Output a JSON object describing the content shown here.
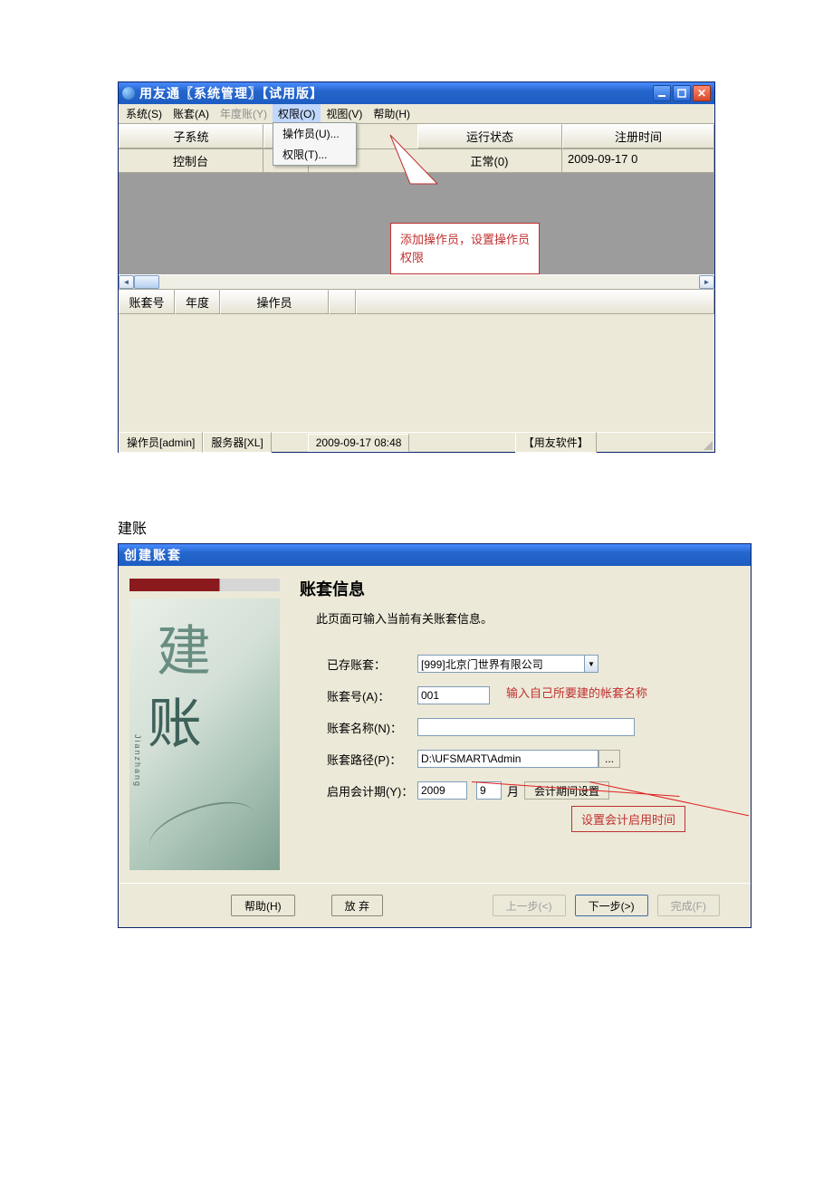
{
  "win1": {
    "title": "用友通〖系统管理〗【试用版】",
    "menu": {
      "system": "系统(S)",
      "account": "账套(A)",
      "year": "年度账(Y)",
      "auth": "权限(O)",
      "view": "视图(V)",
      "help": "帮助(H)"
    },
    "dropdown": {
      "operator": "操作员(U)...",
      "permission": "权限(T)..."
    },
    "cols": {
      "subsystem": "子系统",
      "runstate": "运行状态",
      "regtime": "注册时间"
    },
    "row": {
      "console": "控制台",
      "normal": "正常(0)",
      "time": "2009-09-17 0"
    },
    "callout": "添加操作员，设置操作员权限",
    "cols2": {
      "acct": "账套号",
      "year": "年度",
      "op": "操作员"
    },
    "status": {
      "op": "操作员[admin]",
      "srv": "服务器[XL]",
      "time": "2009-09-17 08:48",
      "brand": "【用友软件】"
    }
  },
  "section_label": "建账",
  "win2": {
    "title": "创建账套",
    "side": {
      "h1": "建",
      "h2": "账",
      "pinyin": "Jianzhang"
    },
    "heading": "账套信息",
    "subheading": "此页面可输入当前有关账套信息。",
    "labels": {
      "exist": "已存账套：",
      "num": "账套号(A)：",
      "name": "账套名称(N)：",
      "path": "账套路径(P)：",
      "period": "启用会计期(Y)："
    },
    "values": {
      "exist": "[999]北京门世界有限公司",
      "num": "001",
      "name": "",
      "path": "D:\\UFSMART\\Admin",
      "year": "2009",
      "month": "9"
    },
    "units": {
      "month": "月"
    },
    "buttons": {
      "browse": "...",
      "period_setting": "会计期间设置",
      "help": "帮助(H)",
      "cancel": "放 弃",
      "prev": "上一步(<)",
      "next": "下一步(>)",
      "finish": "完成(F)"
    },
    "notes": {
      "name": "输入自己所要建的帐套名称",
      "period": "设置会计启用时间"
    }
  }
}
